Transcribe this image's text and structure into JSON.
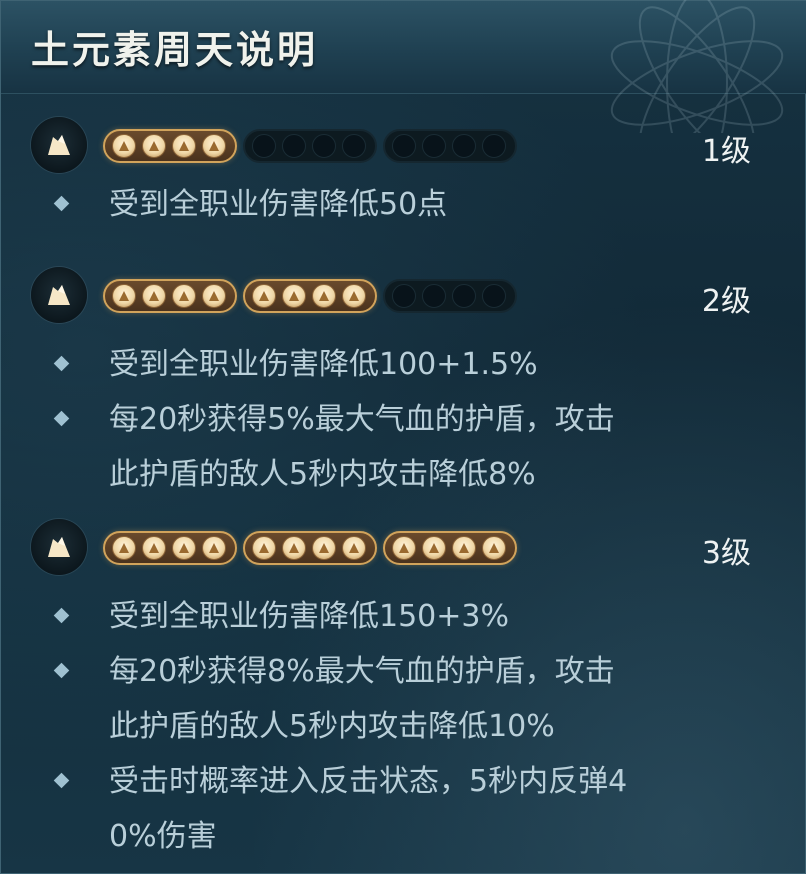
{
  "title": "土元素周天说明",
  "colors": {
    "accent_gold": "#d1a35b",
    "text_light": "#b9cfd9",
    "level_text": "#eef2f2"
  },
  "tiers": [
    {
      "level": "1级",
      "groups_active": [
        true,
        false,
        false
      ],
      "lines": [
        "受到全职业伤害降低50点"
      ]
    },
    {
      "level": "2级",
      "groups_active": [
        true,
        true,
        false
      ],
      "lines": [
        "受到全职业伤害降低100+1.5%",
        "每20秒获得5%最大气血的护盾，攻击",
        "此护盾的敌人5秒内攻击降低8%"
      ]
    },
    {
      "level": "3级",
      "groups_active": [
        true,
        true,
        true
      ],
      "lines": [
        "受到全职业伤害降低150+3%",
        "每20秒获得8%最大气血的护盾，攻击",
        "此护盾的敌人5秒内攻击降低10%",
        "受击时概率进入反击状态，5秒内反弹4",
        "0%伤害"
      ]
    }
  ]
}
